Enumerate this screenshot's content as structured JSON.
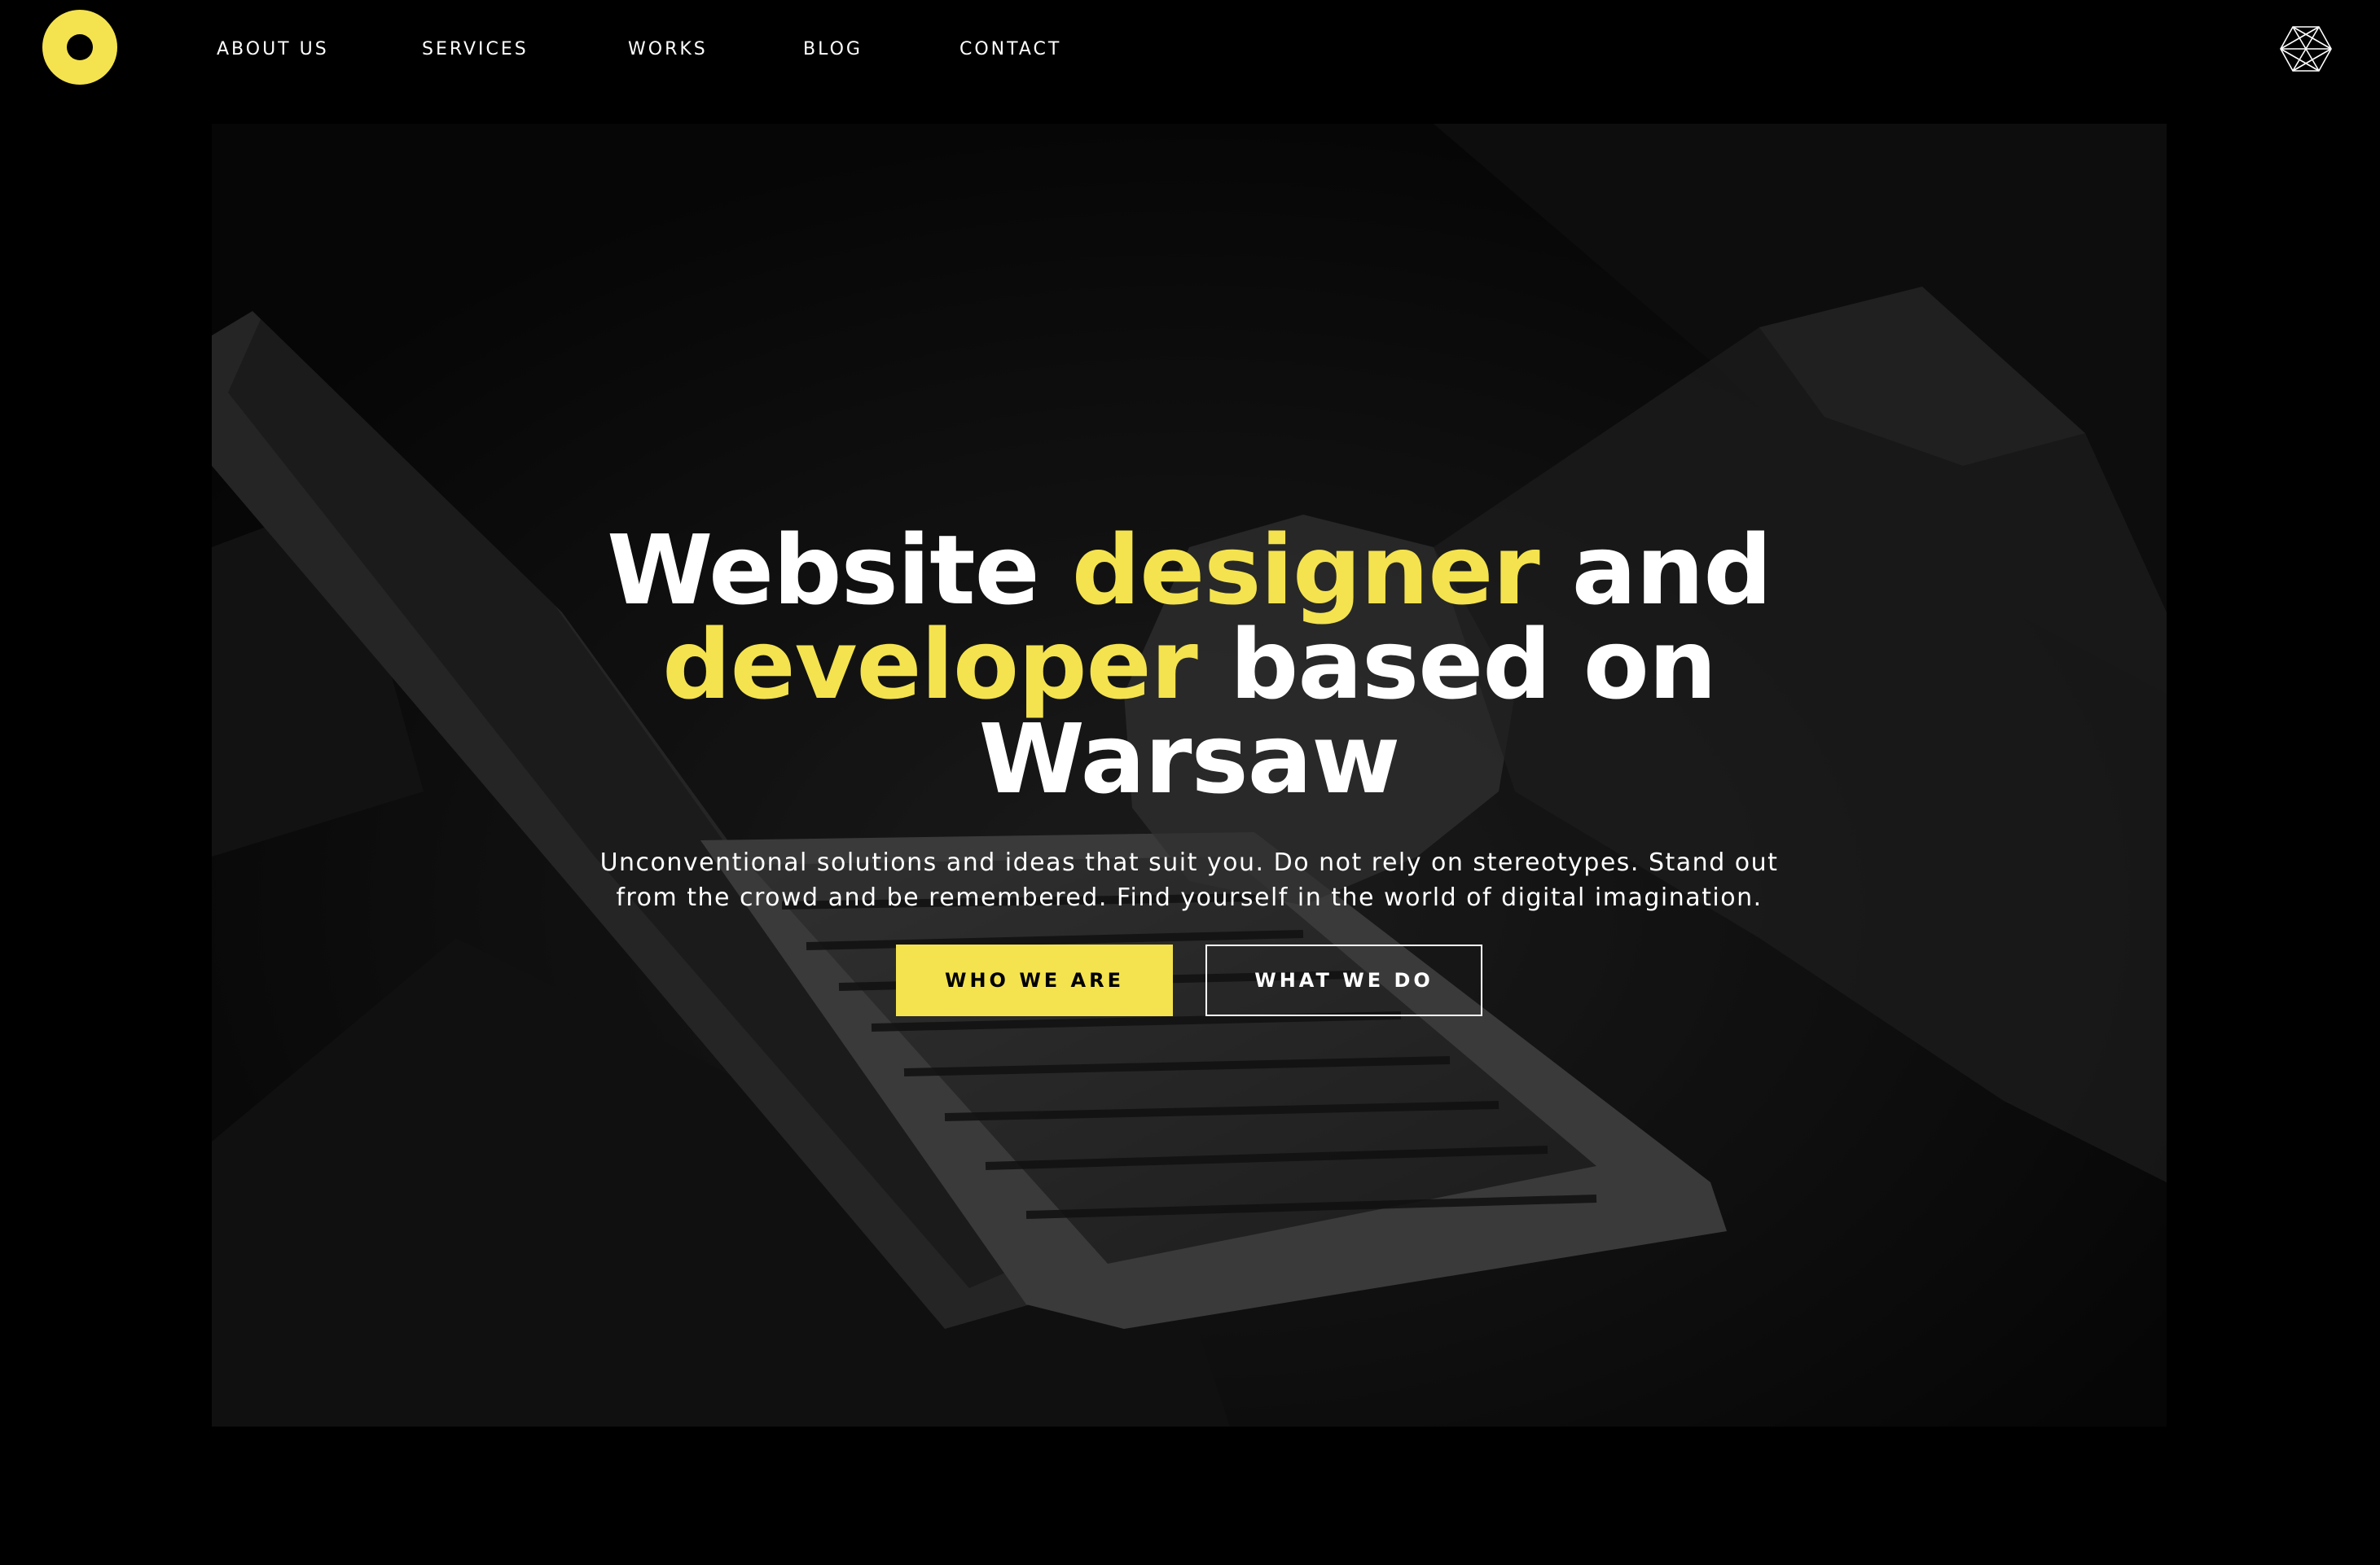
{
  "header": {
    "logo_icon": "ring-logo-icon",
    "nav": [
      {
        "label": "ABOUT US"
      },
      {
        "label": "SERVICES"
      },
      {
        "label": "WORKS"
      },
      {
        "label": "BLOG"
      },
      {
        "label": "CONTACT"
      }
    ],
    "menu_icon": "hexagon-wireframe-icon"
  },
  "hero": {
    "background_image": "laptop-hands-photo",
    "headline": {
      "part1": "Website ",
      "accent1": "designer",
      "part2": " and",
      "accent2": "developer",
      "part3": " based on",
      "part4": "Warsaw"
    },
    "subtext_line1": "Unconventional solutions and ideas that suit you. Do not rely on stereotypes. Stand out",
    "subtext_line2": "from the crowd and be remembered. Find yourself in the world of digital imagination.",
    "primary_button": "WHO WE ARE",
    "secondary_button": "WHAT WE DO"
  },
  "colors": {
    "accent": "#f4e34f",
    "background": "#000000",
    "text": "#ffffff"
  }
}
